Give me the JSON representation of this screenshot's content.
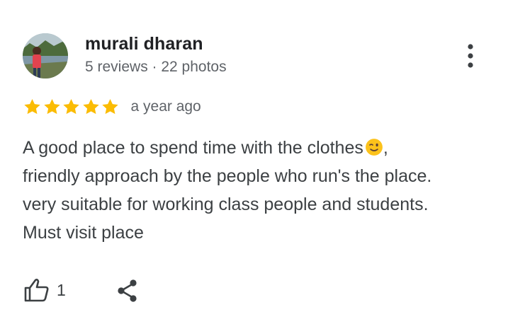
{
  "reviewer": {
    "name": "murali dharan",
    "meta": "5 reviews · 22 photos",
    "avatar_icon": "profile-photo"
  },
  "rating": {
    "value": 5,
    "max": 5,
    "date": "a year ago",
    "star_color": "#fbbc04"
  },
  "review": {
    "lines": [
      "A good place to spend time with the clothes",
      "friendly approach by the people who run's the place.",
      "very suitable for working class people and students.",
      "Must visit place"
    ],
    "emoji_icon": "winking-face-emoji",
    "after_emoji": ","
  },
  "actions": {
    "like_icon": "thumbs-up-icon",
    "like_count": "1",
    "share_icon": "share-icon",
    "more_icon": "more-vertical-icon"
  }
}
